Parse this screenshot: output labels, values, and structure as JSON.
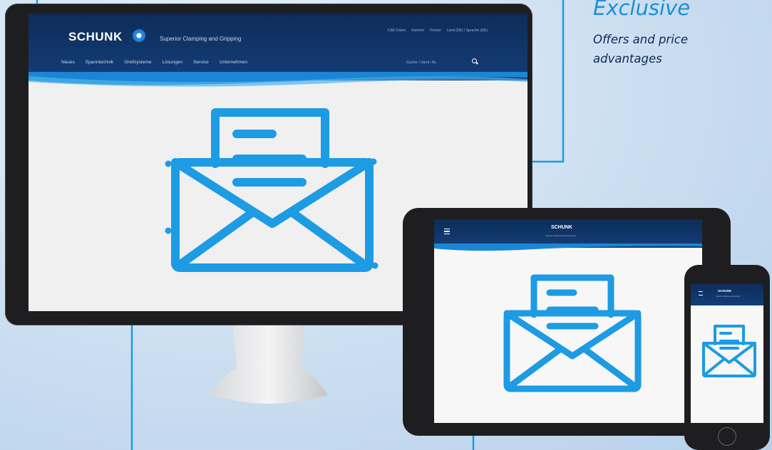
{
  "callout": {
    "title": "Exclusive",
    "body": "Offers and price advantages"
  },
  "monitor": {
    "logo": "SCHUNK",
    "tagline": "Superior Clamping and Gripping",
    "top_nav": [
      "CAD Daten",
      "Karriere",
      "Presse",
      "Land (DE) / Sprache (DE)"
    ],
    "main_nav": [
      "Neues",
      "Spanntechnik",
      "Greifsysteme",
      "Lösungen",
      "Service",
      "Unternehmen"
    ],
    "search_placeholder": "Suche / Ident.-Nr.",
    "search_icon": "search-icon"
  },
  "tablet": {
    "logo": "SCHUNK",
    "tagline": "Superior Clamping and Gripping",
    "menu_icon": "menu-icon"
  },
  "phone": {
    "logo": "SCHUNK",
    "tagline": "Superior Clamping and Gripping",
    "menu_icon": "menu-icon"
  },
  "envelope_icon": "envelope-open-letter-icon",
  "colors": {
    "accent": "#1d9be3",
    "header": "#0d2c5a",
    "callout_title": "#1d8fd6",
    "callout_text": "#0d2a52"
  }
}
